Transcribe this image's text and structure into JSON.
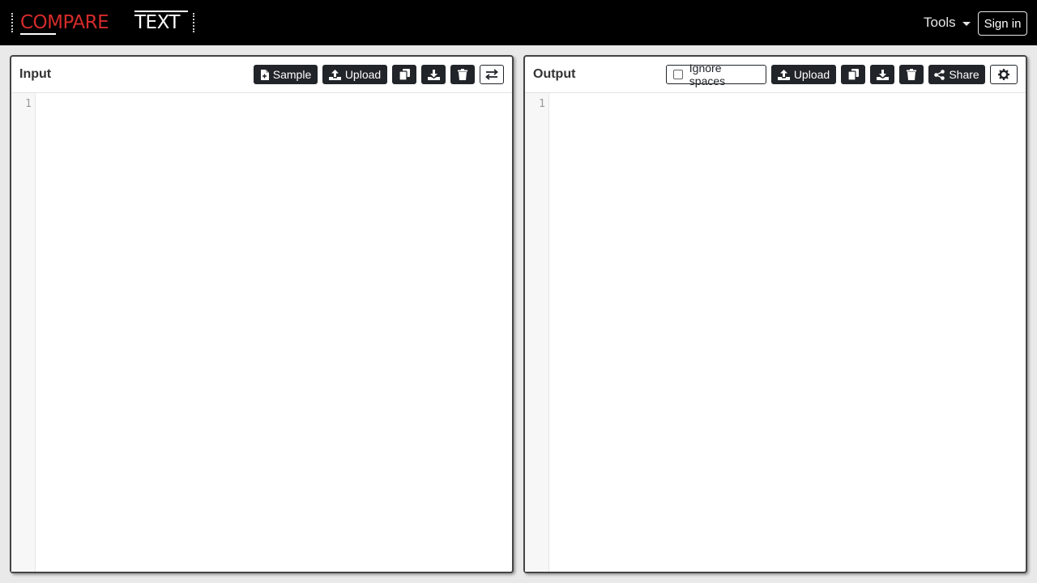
{
  "navbar": {
    "logo_word1": "COMPARE",
    "logo_word2": "TEXT",
    "tools_label": "Tools",
    "signin_label": "Sign in"
  },
  "input_panel": {
    "title": "Input",
    "sample_label": "Sample",
    "upload_label": "Upload",
    "line_numbers": [
      "1"
    ]
  },
  "output_panel": {
    "title": "Output",
    "ignore_spaces_label": "Ignore spaces",
    "upload_label": "Upload",
    "share_label": "Share",
    "line_numbers": [
      "1"
    ]
  },
  "colors": {
    "navbar_bg": "#000000",
    "logo_red": "#d52b2b",
    "button_dark": "#212529"
  }
}
